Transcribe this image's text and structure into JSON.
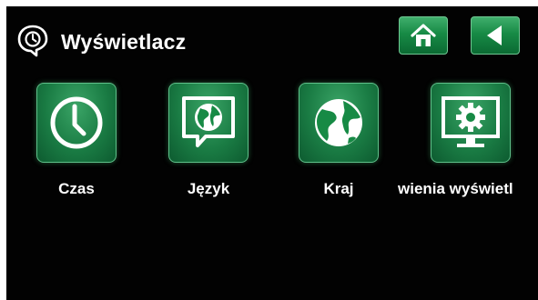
{
  "header": {
    "title": "Wyświetlacz",
    "title_icon": "speech-bubble-clock-icon",
    "home_icon": "home-icon",
    "back_icon": "back-arrow-icon"
  },
  "tiles": [
    {
      "label": "Czas",
      "icon": "clock-icon"
    },
    {
      "label": "Język",
      "icon": "globe-speech-bubble-icon"
    },
    {
      "label": "Kraj",
      "icon": "globe-icon"
    },
    {
      "label": "wienia wyświetl",
      "icon": "monitor-gear-icon"
    }
  ],
  "colors": {
    "background": "#020202",
    "accent_green": "#178a45",
    "text": "#ffffff"
  }
}
